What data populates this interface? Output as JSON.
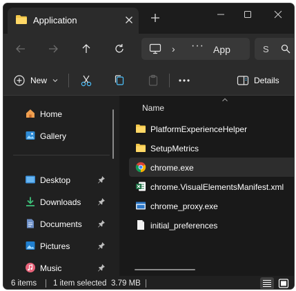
{
  "tab": {
    "title": "Application",
    "icon": "folder-icon"
  },
  "window_controls": [
    "minimize-icon",
    "maximize-icon",
    "close-icon"
  ],
  "address": {
    "crumb": "App",
    "more": "···"
  },
  "search": {
    "placeholder": "S"
  },
  "commands": {
    "new_label": "New",
    "details_label": "Details"
  },
  "sidebar": {
    "items": [
      {
        "label": "Home",
        "icon": "home-icon"
      },
      {
        "label": "Gallery",
        "icon": "gallery-icon"
      },
      {
        "label": "Desktop",
        "icon": "desktop-icon"
      },
      {
        "label": "Downloads",
        "icon": "downloads-icon"
      },
      {
        "label": "Documents",
        "icon": "documents-icon"
      },
      {
        "label": "Pictures",
        "icon": "pictures-icon"
      },
      {
        "label": "Music",
        "icon": "music-icon"
      }
    ]
  },
  "files": {
    "column_header": "Name",
    "rows": [
      {
        "name": "PlatformExperienceHelper",
        "icon": "folder-icon"
      },
      {
        "name": "SetupMetrics",
        "icon": "folder-icon"
      },
      {
        "name": "chrome.exe",
        "icon": "chrome-icon"
      },
      {
        "name": "chrome.VisualElementsManifest.xml",
        "icon": "excel-xml-icon"
      },
      {
        "name": "chrome_proxy.exe",
        "icon": "exe-window-icon"
      },
      {
        "name": "initial_preferences",
        "icon": "file-icon"
      }
    ]
  },
  "status": {
    "item_count": "6 items",
    "selection": "1 item selected",
    "size": "3.79 MB"
  },
  "colors": {
    "window_bg": "#202020",
    "toolbar_bg": "#2b2b2b",
    "content_bg": "#191919",
    "folder_yellow": "#f2c74a",
    "accent_blue": "#4cc2ff"
  }
}
